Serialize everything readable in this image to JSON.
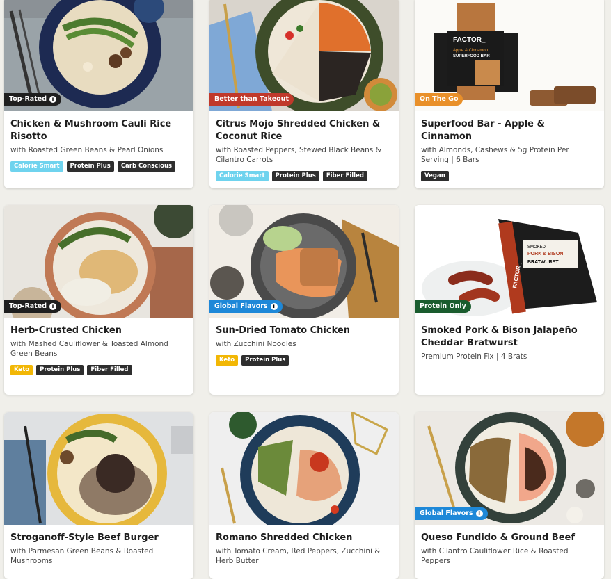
{
  "colors": {
    "top_rated": "#1f1f1f",
    "better_than_takeout": "#c0392b",
    "on_the_go": "#e9902a",
    "global_flavors": "#1e88d8",
    "protein_only": "#1a5c2e",
    "tag_calorie_smart": "#6fd3ee",
    "tag_keto": "#f2b705",
    "tag_default": "#2e2e2e"
  },
  "meals": [
    {
      "badge": "Top-Rated",
      "title": "Chicken & Mushroom Cauli Rice Risotto",
      "subtitle": "with Roasted Green Beans & Pearl Onions",
      "tags": [
        "Calorie Smart",
        "Protein Plus",
        "Carb Conscious"
      ]
    },
    {
      "badge": "Better than Takeout",
      "title": "Citrus Mojo Shredded Chicken & Coconut Rice",
      "subtitle": "with Roasted Peppers, Stewed Black Beans & Cilantro Carrots",
      "tags": [
        "Calorie Smart",
        "Protein Plus",
        "Fiber Filled"
      ]
    },
    {
      "badge": "On The Go",
      "title": "Superfood Bar - Apple & Cinnamon",
      "subtitle": "with Almonds, Cashews & 5g Protein Per Serving | 6 Bars",
      "tags": [
        "Vegan"
      ],
      "packaging_text": [
        "FACTOR_",
        "Apple & Cinnamon",
        "SUPERFOOD BAR"
      ]
    },
    {
      "badge": "Top-Rated",
      "title": "Herb-Crusted Chicken",
      "subtitle": "with Mashed Cauliflower & Toasted Almond Green Beans",
      "tags": [
        "Keto",
        "Protein Plus",
        "Fiber Filled"
      ]
    },
    {
      "badge": "Global Flavors",
      "title": "Sun-Dried Tomato Chicken",
      "subtitle": "with Zucchini Noodles",
      "tags": [
        "Keto",
        "Protein Plus"
      ]
    },
    {
      "badge": "Protein Only",
      "title": "Smoked Pork & Bison Jalapeño Cheddar Bratwurst",
      "subtitle": "Premium Protein Fix | 4 Brats",
      "tags": [],
      "packaging_text": [
        "FACTOR_",
        "SMOKED",
        "PORK & BISON",
        "BRATWURST"
      ]
    },
    {
      "badge": "",
      "title": "Stroganoff-Style Beef Burger",
      "subtitle": "with Parmesan Green Beans & Roasted Mushrooms",
      "tags": []
    },
    {
      "badge": "",
      "title": "Romano Shredded Chicken",
      "subtitle": "with Tomato Cream, Red Peppers, Zucchini & Herb Butter",
      "tags": []
    },
    {
      "badge": "Global Flavors",
      "title": "Queso Fundido & Ground Beef",
      "subtitle": "with Cilantro Cauliflower Rice & Roasted Peppers",
      "tags": []
    }
  ]
}
